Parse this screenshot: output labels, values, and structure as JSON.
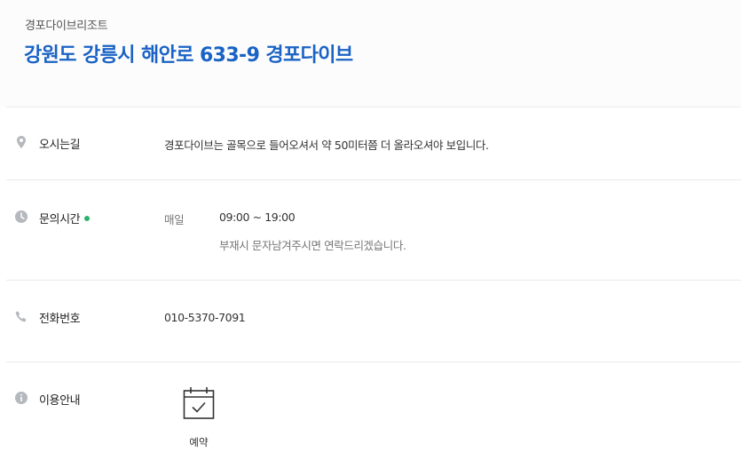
{
  "header": {
    "subtitle": "경포다이브리조트",
    "title": "강원도 강릉시 해안로 633-9 경포다이브"
  },
  "directions": {
    "icon": "location-pin-icon",
    "label": "오시는길",
    "text": "경포다이브는 골목으로 들어오셔서 약 50미터쯤 더 올라오셔야 보입니다."
  },
  "hours": {
    "icon": "clock-icon",
    "label": "문의시간",
    "status_color": "#2db36a",
    "day": "매일",
    "time": "09:00 ~ 19:00",
    "note": "부재시 문자남겨주시면 연락드리겠습니다."
  },
  "phone": {
    "icon": "phone-icon",
    "label": "전화번호",
    "number": "010-5370-7091"
  },
  "usage": {
    "icon": "info-icon",
    "label": "이용안내",
    "reserve_icon": "calendar-check-icon",
    "reserve_label": "예약"
  },
  "colors": {
    "accent": "#1a63c5",
    "icon_gray": "#b5b8bd",
    "divider": "#ebebeb"
  }
}
